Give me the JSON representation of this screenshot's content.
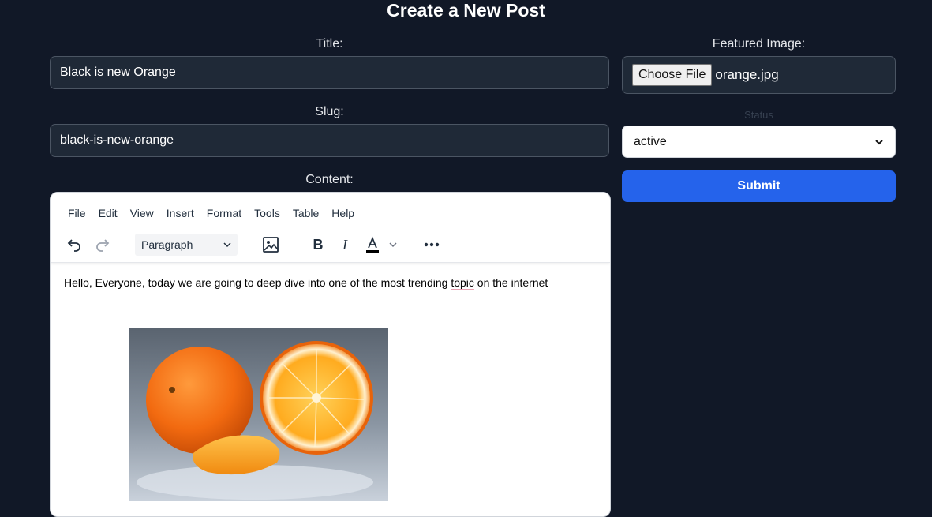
{
  "page": {
    "title": "Create a New Post"
  },
  "form": {
    "title_label": "Title:",
    "title_value": "Black is new Orange",
    "slug_label": "Slug:",
    "slug_value": "black-is-new-orange",
    "content_label": "Content:",
    "featured_label": "Featured Image:",
    "choose_file_label": "Choose File",
    "file_name": "orange.jpg",
    "status_label": "Status",
    "status_value": "active",
    "submit_label": "Submit"
  },
  "editor": {
    "menu": [
      "File",
      "Edit",
      "View",
      "Insert",
      "Format",
      "Tools",
      "Table",
      "Help"
    ],
    "block_format": "Paragraph",
    "content_before": "Hello, Everyone, today we are going to deep dive into one of the most trending ",
    "content_misspelled": "topic",
    "content_after": " on the internet",
    "toolbar_icons": [
      "undo-icon",
      "redo-icon",
      "image-icon",
      "bold-icon",
      "italic-icon",
      "text-color-icon",
      "more-icon"
    ]
  },
  "colors": {
    "background": "#111827",
    "input_bg": "#1f2937",
    "submit": "#2563eb"
  }
}
